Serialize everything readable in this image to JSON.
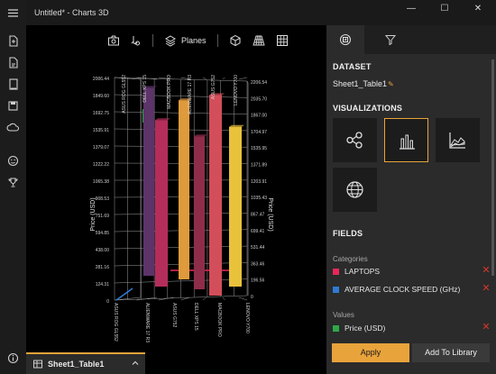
{
  "window": {
    "title": "Untitled* - Charts 3D",
    "minimize": "—",
    "maximize": "☐",
    "close": "✕"
  },
  "rail": {
    "icons": [
      "hamburger-menu-icon",
      "new-file-icon",
      "open-file-icon",
      "document-icon",
      "save-icon",
      "share-cloud-icon",
      "feedback-icon",
      "trophy-icon",
      "info-icon"
    ]
  },
  "toolbar": {
    "planes_label": "Planes",
    "icons": [
      "camera-icon",
      "settings-touch-icon",
      "layers-icon",
      "cube-icon",
      "grid-perspective-icon",
      "grid-icon"
    ]
  },
  "chart_data": {
    "type": "bar",
    "categories": [
      "ASUS ROG GL552",
      "ALIENWARE 17 R3",
      "ASUS G752",
      "DELL XPS 15",
      "MACBOOK PRO",
      "LENOVO Y700"
    ],
    "top_categories": [
      "ASUS ROG GL552",
      "DELL XPS 15",
      "MACBOOK PRO",
      "ALIENWARE 17 R3",
      "ASUS G752",
      "LENOVO Y700"
    ],
    "values": [
      1800,
      1610,
      1750,
      1510,
      2000,
      1610
    ],
    "colors": [
      "#5c3468",
      "#b42d5b",
      "#df9a3b",
      "#8e2d4a",
      "#d24e5a",
      "#e9c23b"
    ],
    "ylabel": "Price (USD)",
    "xlabel": "LAPTOPS",
    "ylim": [
      0,
      2200
    ],
    "left_ticks": [
      "2006.44",
      "1849.60",
      "1692.75",
      "1535.91",
      "1379.07",
      "1222.22",
      "1065.38",
      "908.53",
      "751.69",
      "594.85",
      "438.00",
      "281.16",
      "124.31",
      "0"
    ],
    "right_ticks": [
      "2206.54",
      "2035.70",
      "1867.00",
      "1704.97",
      "1535.95",
      "1371.89",
      "1203.91",
      "1035.43",
      "867.47",
      "699.41",
      "531.44",
      "363.46",
      "196.56",
      "0"
    ],
    "grid": true,
    "perspective": "3d"
  },
  "sheet_tab": {
    "label": "Sheet1_Table1"
  },
  "panel": {
    "tabs": [
      "data-chart-icon",
      "filter-icon"
    ],
    "dataset_heading": "DATASET",
    "dataset_name": "Sheet1_Table1",
    "dataset_edit": "✎",
    "visualizations_heading": "VISUALIZATIONS",
    "visualizations": [
      "scatter-bubble-icon",
      "bar-chart-icon",
      "area-chart-icon",
      "globe-icon"
    ],
    "fields_heading": "FIELDS",
    "categories_label": "Categories",
    "categories": [
      {
        "name": "LAPTOPS",
        "color": "#e8285a"
      },
      {
        "name": "AVERAGE CLOCK SPEED (GHz)",
        "color": "#2f7ad6"
      }
    ],
    "values_label": "Values",
    "values": [
      {
        "name": "Price (USD)",
        "color": "#2ea84a"
      }
    ],
    "remove_glyph": "✕",
    "apply_label": "Apply",
    "add_library_label": "Add To Library"
  }
}
